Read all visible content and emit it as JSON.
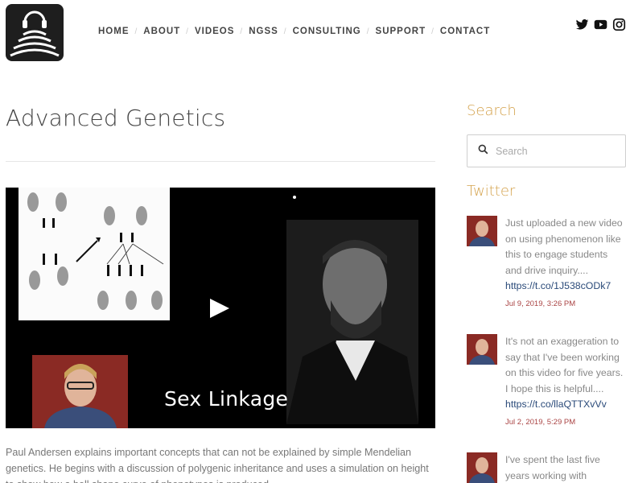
{
  "nav": {
    "items": [
      "HOME",
      "ABOUT",
      "VIDEOS",
      "NGSS",
      "CONSULTING",
      "SUPPORT",
      "CONTACT"
    ]
  },
  "social": {
    "icons": [
      "twitter-icon",
      "youtube-icon",
      "instagram-icon"
    ]
  },
  "page": {
    "title": "Advanced Genetics"
  },
  "video": {
    "caption": "Sex Linkage"
  },
  "description": "Paul Andersen explains important concepts that can not be explained by simple Mendelian genetics. He begins with a discussion of polygenic inheritance and uses a simulation on height to show how a bell shape curve of phenotypes is produced.",
  "sidebar": {
    "search_heading": "Search",
    "search_placeholder": "Search",
    "twitter_heading": "Twitter",
    "tweets": [
      {
        "text": "Just uploaded a new video on using phenomenon like this to engage students and drive inquiry....",
        "link": "https://t.co/1J538cODk7",
        "date": "Jul 9, 2019, 3:26 PM"
      },
      {
        "text": "It's not an exaggeration to say that I've been working on this video for five years. I hope this is helpful....",
        "link": "https://t.co/llaQTTXvVv",
        "date": "Jul 2, 2019, 5:29 PM"
      },
      {
        "text": "I've spent the last five years working with",
        "link": "",
        "date": ""
      }
    ]
  },
  "colors": {
    "accent": "#d4a24c",
    "link": "#2a4a79",
    "date": "#aa4444"
  }
}
